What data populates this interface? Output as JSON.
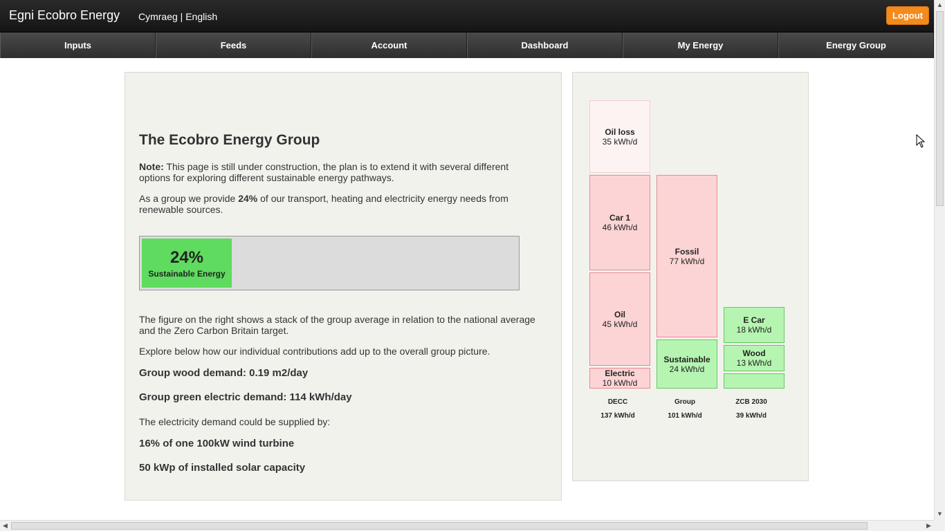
{
  "header": {
    "brand": "Egni Ecobro Energy",
    "lang_cy": "Cymraeg",
    "lang_sep": " | ",
    "lang_en": "English",
    "logout": "Logout"
  },
  "nav": [
    "Inputs",
    "Feeds",
    "Account",
    "Dashboard",
    "My Energy",
    "Energy Group"
  ],
  "main": {
    "title": "The Ecobro Energy Group",
    "note_label": "Note:",
    "note_text": " This page is still under construction, the plan is to extend it with several different options for exploring different sustainable energy pathways.",
    "provide_pre": "As a group we provide ",
    "provide_pct": "24%",
    "provide_post": " of our transport, heating and electricity energy needs from renewable sources.",
    "progress": {
      "value": 0.24,
      "pct_label": "24%",
      "label": "Sustainable Energy"
    },
    "figure_text": "The figure on the right shows a stack of the group average in relation to the national average and the Zero Carbon Britain target.",
    "explore_text": "Explore below how our individual contributions add up to the overall group picture.",
    "wood_demand": "Group wood demand: 0.19 m2/day",
    "electric_demand": "Group green electric demand: 114 kWh/day",
    "supply_text": "The electricity demand could be supplied by:",
    "wind_text": "16% of one 100kW wind turbine",
    "solar_text": "50 kWp of installed solar capacity"
  },
  "stack": {
    "decc": {
      "name": "DECC",
      "total": "137 kWh/d",
      "blocks": [
        {
          "name": "Oil loss",
          "value": "35 kWh/d"
        },
        {
          "name": "Car 1",
          "value": "46 kWh/d"
        },
        {
          "name": "Oil",
          "value": "45 kWh/d"
        },
        {
          "name": "Electric",
          "value": "10 kWh/d"
        }
      ]
    },
    "group": {
      "name": "Group",
      "total": "101 kWh/d",
      "blocks": [
        {
          "name": "Fossil",
          "value": "77 kWh/d"
        },
        {
          "name": "Sustainable",
          "value": "24 kWh/d"
        }
      ]
    },
    "zcb": {
      "name": "ZCB 2030",
      "total": "39 kWh/d",
      "blocks": [
        {
          "name": "E Car",
          "value": "18 kWh/d"
        },
        {
          "name": "Wood",
          "value": "13 kWh/d"
        }
      ]
    }
  },
  "colors": {
    "accent": "#f28b1e",
    "progress": "#5fdb5f",
    "red_block": "#fcd4d6",
    "green_block": "#b6f5b1"
  }
}
